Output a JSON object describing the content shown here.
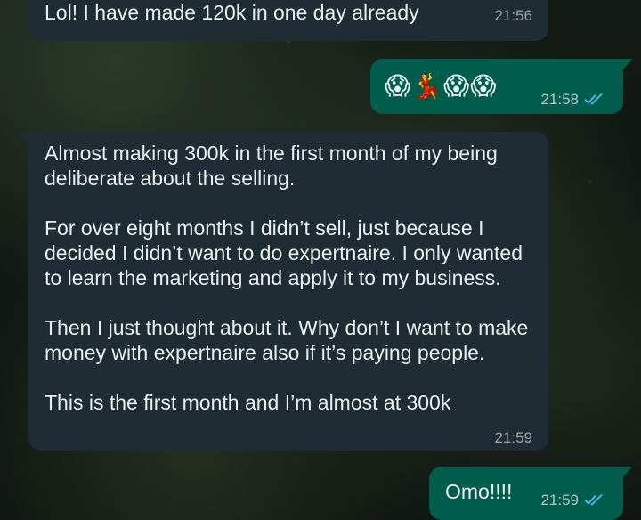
{
  "colors": {
    "incoming_bubble": "#1f2c34",
    "outgoing_bubble": "#005c4b",
    "text": "#e9edef",
    "read_ticks": "#53bdeb"
  },
  "messages": [
    {
      "direction": "incoming",
      "text": "Lol! I have made 120k in one day already",
      "time": "21:56"
    },
    {
      "direction": "outgoing",
      "emojis": "😱💃😱😱",
      "emoji_names": [
        "screaming-face-emoji",
        "dancer-emoji",
        "screaming-face-emoji",
        "screaming-face-emoji"
      ],
      "time": "21:58",
      "status_icon": "double-check-read-icon"
    },
    {
      "direction": "incoming",
      "paragraphs": [
        "Almost making 300k in the first month of my being deliberate about the selling.",
        "For over eight months I didn’t sell, just because I decided I didn’t want to do expertnaire. I only wanted to learn the marketing and apply it to my business.",
        "Then I just thought about it. Why don’t I want to make money with expertnaire also if it’s paying people.",
        "This is the first month and I’m almost at 300k"
      ],
      "time": "21:59"
    },
    {
      "direction": "outgoing",
      "text": "Omo!!!!",
      "time": "21:59",
      "status_icon": "double-check-read-icon"
    }
  ]
}
